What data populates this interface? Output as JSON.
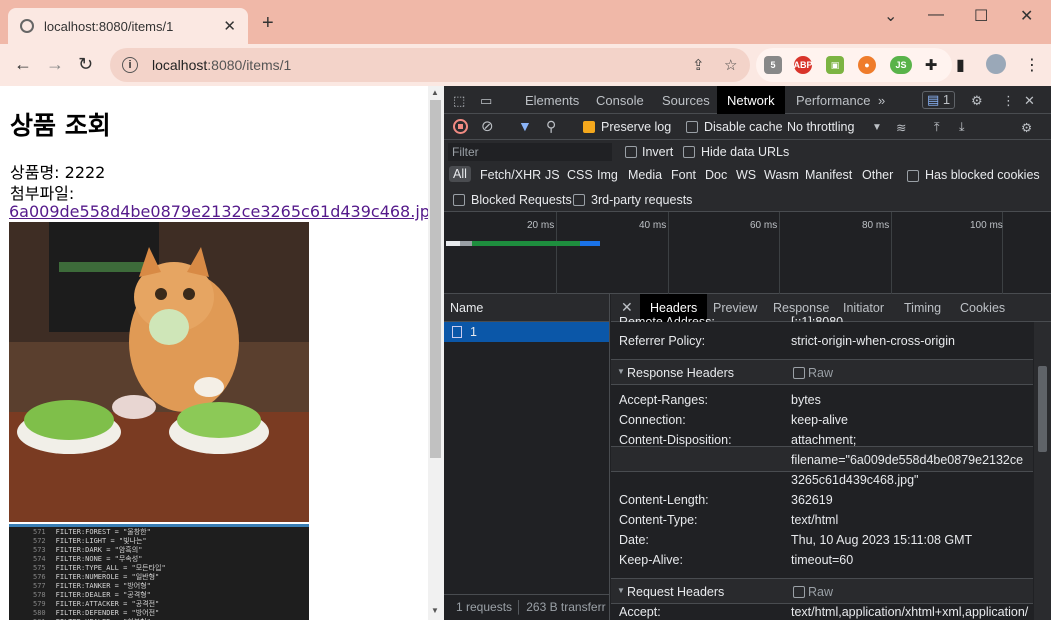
{
  "browser": {
    "tab_title": "localhost:8080/items/1",
    "url_host": "localhost",
    "url_path": ":8080/items/1"
  },
  "page": {
    "heading": "상품 조회",
    "product_line": "상품명: 2222",
    "attach_label": "첨부파일:",
    "file_link": "6a009de558d4be0879e2132ce3265c61d439c468.jpg"
  },
  "code_lines": [
    {
      "n": "571",
      "t": "FILTER:FOREST = \"울창한\""
    },
    {
      "n": "572",
      "t": "FILTER:LIGHT = \"빛나는\""
    },
    {
      "n": "573",
      "t": "FILTER:DARK = \"암흑의\""
    },
    {
      "n": "574",
      "t": "FILTER:NONE = \"무속성\""
    },
    {
      "n": "575",
      "t": "FILTER:TYPE_ALL = \"모든타입\""
    },
    {
      "n": "576",
      "t": "FILTER:NUMEROLE = \"일반형\""
    },
    {
      "n": "577",
      "t": "FILTER:TANKER = \"방어형\""
    },
    {
      "n": "578",
      "t": "FILTER:DEALER = \"공격형\""
    },
    {
      "n": "579",
      "t": "FILTER:ATTACKER = \"공격전\""
    },
    {
      "n": "580",
      "t": "FILTER:DEFENDER = \"방어전\""
    },
    {
      "n": "581",
      "t": "FILTER:HEALER = \"회복형\""
    }
  ],
  "devtools": {
    "tabs": [
      "Elements",
      "Console",
      "Sources",
      "Network",
      "Performance"
    ],
    "active_tab": "Network",
    "issues_count": "1",
    "preserve_log": "Preserve log",
    "disable_cache": "Disable cache",
    "throttling": "No throttling",
    "filter_placeholder": "Filter",
    "invert": "Invert",
    "hide_data_urls": "Hide data URLs",
    "types": [
      "All",
      "Fetch/XHR",
      "JS",
      "CSS",
      "Img",
      "Media",
      "Font",
      "Doc",
      "WS",
      "Wasm",
      "Manifest",
      "Other"
    ],
    "has_blocked_cookies": "Has blocked cookies",
    "blocked_requests": "Blocked Requests",
    "third_party": "3rd-party requests",
    "timeline_ticks": [
      "20 ms",
      "40 ms",
      "60 ms",
      "80 ms",
      "100 ms"
    ],
    "name_header": "Name",
    "request_name": "1",
    "footer": "1 requests",
    "footer2": "263 B transferr",
    "detail_tabs": [
      "Headers",
      "Preview",
      "Response",
      "Initiator",
      "Timing",
      "Cookies"
    ],
    "general_top": [
      {
        "k": "Remote Address:",
        "v": "[::1]:8080"
      },
      {
        "k": "Referrer Policy:",
        "v": "strict-origin-when-cross-origin"
      }
    ],
    "response_headers_title": "Response Headers",
    "raw": "Raw",
    "response_headers": [
      {
        "k": "Accept-Ranges:",
        "v": "bytes"
      },
      {
        "k": "Connection:",
        "v": "keep-alive"
      },
      {
        "k": "Content-Disposition:",
        "v": "attachment;"
      },
      {
        "k": "",
        "v": "filename=\"6a009de558d4be0879e2132ce"
      },
      {
        "k": "",
        "v": "3265c61d439c468.jpg\""
      },
      {
        "k": "Content-Length:",
        "v": "362619"
      },
      {
        "k": "Content-Type:",
        "v": "text/html"
      },
      {
        "k": "Date:",
        "v": "Thu, 10 Aug 2023 15:11:08 GMT"
      },
      {
        "k": "Keep-Alive:",
        "v": "timeout=60"
      }
    ],
    "request_headers_title": "Request Headers",
    "request_first": {
      "k": "Accept:",
      "v": "text/html,application/xhtml+xml,application/"
    }
  }
}
